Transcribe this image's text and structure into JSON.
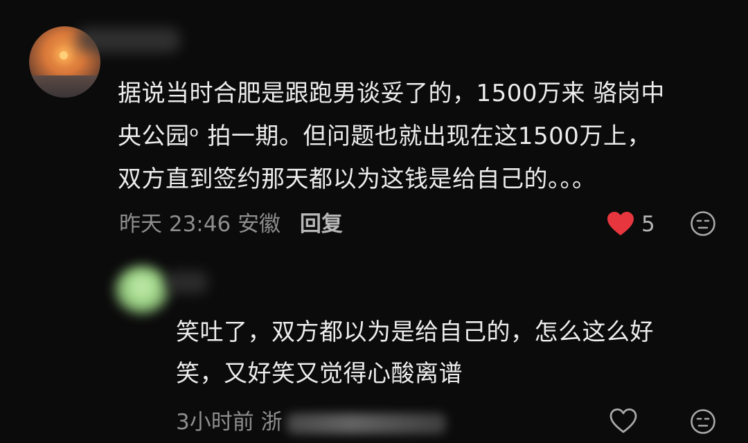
{
  "main_comment": {
    "text_lines": [
      "据说当时合肥是跟跑男谈妥了的，1500万来 骆岗中",
      "央公园ᵒ 拍一期。但问题也就出现在这1500万上，",
      "双方直到签约那天都以为这钱是给自己的。。。"
    ],
    "time": "昨天 23:46",
    "location": "安徽",
    "reply_label": "回复",
    "like_count": "5",
    "liked": true,
    "like_color": "#e8363f"
  },
  "reply_comment": {
    "text_lines": [
      "笑吐了，双方都以为是给自己的，怎么这么好",
      "笑，又好笑又觉得心酸离谱"
    ],
    "time": "3小时前",
    "location_visible": "浙",
    "liked": false
  },
  "icons": {
    "like": "heart-icon",
    "emoji": "neutral-face-icon"
  }
}
